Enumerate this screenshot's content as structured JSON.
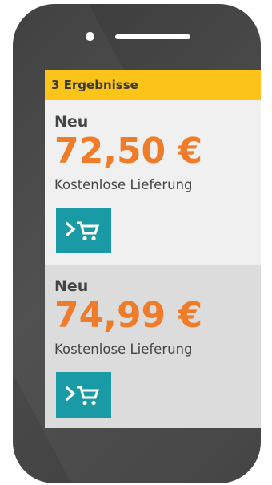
{
  "results_header": "3 Ergebnisse",
  "offers": [
    {
      "condition": "Neu",
      "price": "72,50 €",
      "delivery": "Kostenlose Lieferung",
      "cart_icon": "add-to-cart-icon"
    },
    {
      "condition": "Neu",
      "price": "74,99 €",
      "delivery": "Kostenlose Lieferung",
      "cart_icon": "add-to-cart-icon"
    }
  ],
  "colors": {
    "header_bg": "#fcc419",
    "price": "#f07c2a",
    "cart_button": "#1a9aa4",
    "phone_body": "#444444"
  }
}
